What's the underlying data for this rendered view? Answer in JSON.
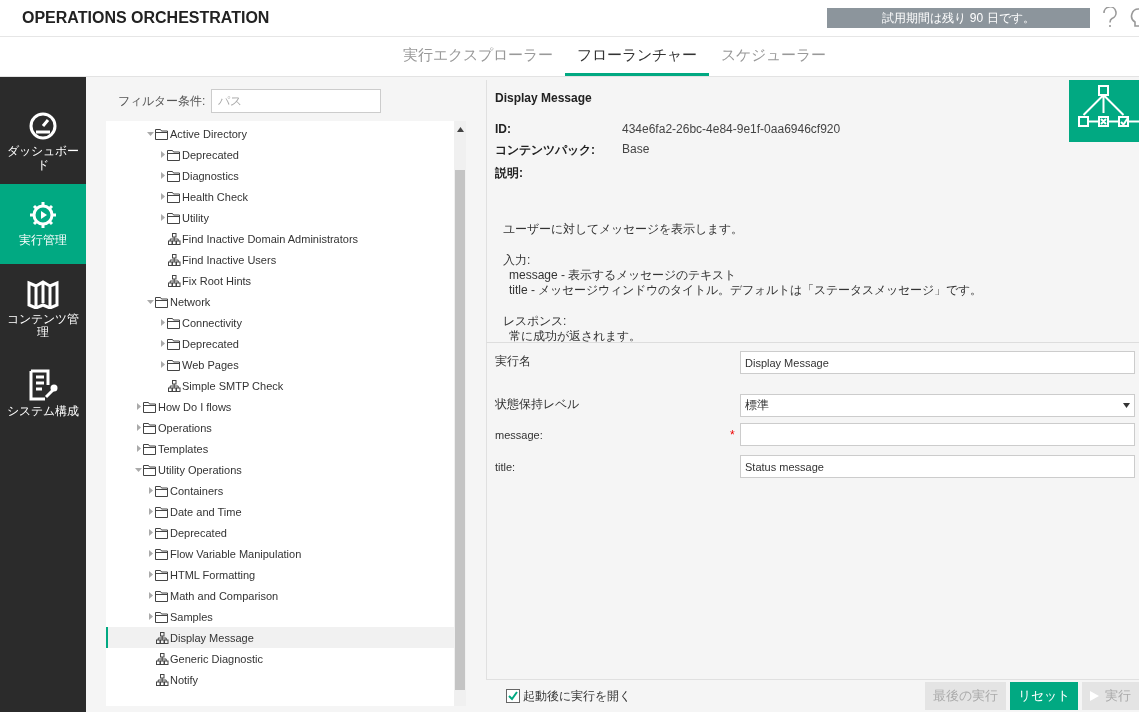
{
  "header": {
    "title": "OPERATIONS ORCHESTRATION",
    "trial_notice": "試用期間は残り 90 日です。"
  },
  "tabs": [
    {
      "label": "実行エクスプローラー",
      "selected": false
    },
    {
      "label": "フローランチャー",
      "selected": true
    },
    {
      "label": "スケジューラー",
      "selected": false
    }
  ],
  "sidebar": {
    "items": [
      {
        "label": "ダッシュボード",
        "kind": "dashboard",
        "selected": false
      },
      {
        "label": "実行管理",
        "kind": "run",
        "selected": true
      },
      {
        "label": "コンテンツ管理",
        "kind": "content",
        "selected": false
      },
      {
        "label": "システム構成",
        "kind": "config",
        "selected": false
      }
    ]
  },
  "filter": {
    "label": "フィルター条件:",
    "placeholder": "パス"
  },
  "tree": {
    "continued": [
      {
        "label": "Active Directory",
        "kind": "folder",
        "expanded": true,
        "selected": false,
        "children": [
          {
            "label": "Deprecated",
            "kind": "folder",
            "expanded": false,
            "selected": false
          },
          {
            "label": "Diagnostics",
            "kind": "folder",
            "expanded": false,
            "selected": false
          },
          {
            "label": "Health Check",
            "kind": "folder",
            "expanded": false,
            "selected": false
          },
          {
            "label": "Utility",
            "kind": "folder",
            "expanded": false,
            "selected": false
          },
          {
            "label": "Find Inactive Domain Administrators",
            "kind": "flow",
            "selected": false
          },
          {
            "label": "Find Inactive Users",
            "kind": "flow",
            "selected": false
          },
          {
            "label": "Fix Root Hints",
            "kind": "flow",
            "selected": false
          }
        ]
      },
      {
        "label": "Network",
        "kind": "folder",
        "expanded": true,
        "selected": false,
        "children": [
          {
            "label": "Connectivity",
            "kind": "folder",
            "expanded": false,
            "selected": false
          },
          {
            "label": "Deprecated",
            "kind": "folder",
            "expanded": false,
            "selected": false
          },
          {
            "label": "Web Pages",
            "kind": "folder",
            "expanded": false,
            "selected": false
          },
          {
            "label": "Simple SMTP Check",
            "kind": "flow",
            "selected": false
          }
        ]
      }
    ],
    "items": [
      {
        "label": "How Do I flows",
        "kind": "folder",
        "expanded": false,
        "selected": false
      },
      {
        "label": "Operations",
        "kind": "folder",
        "expanded": false,
        "selected": false
      },
      {
        "label": "Templates",
        "kind": "folder",
        "expanded": false,
        "selected": false
      },
      {
        "label": "Utility Operations",
        "kind": "folder",
        "expanded": true,
        "selected": false,
        "children": [
          {
            "label": "Containers",
            "kind": "folder",
            "expanded": false,
            "selected": false
          },
          {
            "label": "Date and Time",
            "kind": "folder",
            "expanded": false,
            "selected": false
          },
          {
            "label": "Deprecated",
            "kind": "folder",
            "expanded": false,
            "selected": false
          },
          {
            "label": "Flow Variable Manipulation",
            "kind": "folder",
            "expanded": false,
            "selected": false
          },
          {
            "label": "HTML Formatting",
            "kind": "folder",
            "expanded": false,
            "selected": false
          },
          {
            "label": "Math and Comparison",
            "kind": "folder",
            "expanded": false,
            "selected": false
          },
          {
            "label": "Samples",
            "kind": "folder",
            "expanded": false,
            "selected": false
          },
          {
            "label": "Display Message",
            "kind": "flow",
            "selected": true
          },
          {
            "label": "Generic Diagnostic",
            "kind": "flow",
            "selected": false
          },
          {
            "label": "Notify",
            "kind": "flow",
            "selected": false
          }
        ]
      }
    ]
  },
  "details": {
    "title": "Display Message",
    "fields": [
      {
        "label": "ID:",
        "value": "434e6fa2-26bc-4e84-9e1f-0aa6946cf920"
      },
      {
        "label": "コンテンツパック:",
        "value": "Base"
      },
      {
        "label": "説明:"
      }
    ],
    "description": [
      {
        "heading": "ユーザーに対してメッセージを表示します。"
      },
      {
        "heading": "入力:",
        "lines": [
          "message - 表示するメッセージのテキスト",
          "title - メッセージウィンドウのタイトル。デフォルトは「ステータスメッセージ」です。"
        ]
      },
      {
        "heading": "レスポンス:",
        "lines": [
          "常に成功が返されます。"
        ]
      }
    ]
  },
  "form": {
    "rows": [
      {
        "label": "実行名",
        "kind": "text",
        "value": "Display Message"
      },
      {
        "label": "状態保持レベル",
        "kind": "select",
        "value": "標準"
      },
      {
        "label": "message:",
        "kind": "text",
        "required_mark": "*"
      },
      {
        "label": "title:",
        "kind": "text",
        "value": "Status message"
      }
    ]
  },
  "footer": {
    "checkbox": {
      "label": "起動後に実行を開く",
      "checked": true
    },
    "buttons": [
      {
        "label": "最後の実行",
        "kind": "secondary",
        "disabled": true
      },
      {
        "label": "リセット",
        "kind": "primary",
        "disabled": false
      },
      {
        "label": "実行",
        "kind": "run",
        "disabled": true
      }
    ]
  }
}
